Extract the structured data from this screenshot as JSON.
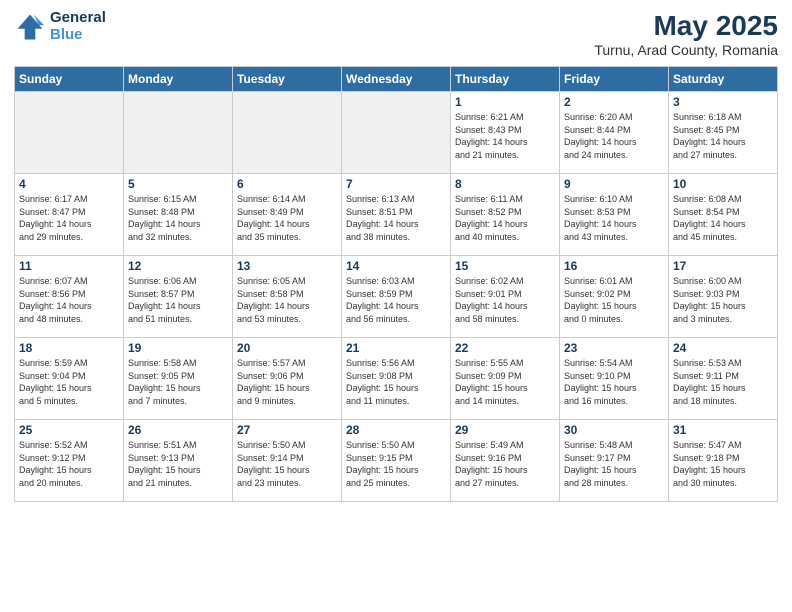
{
  "header": {
    "logo": {
      "general": "General",
      "blue": "Blue"
    },
    "title": "May 2025",
    "subtitle": "Turnu, Arad County, Romania"
  },
  "calendar": {
    "days_of_week": [
      "Sunday",
      "Monday",
      "Tuesday",
      "Wednesday",
      "Thursday",
      "Friday",
      "Saturday"
    ],
    "weeks": [
      [
        {
          "day": "",
          "info": "",
          "empty": true
        },
        {
          "day": "",
          "info": "",
          "empty": true
        },
        {
          "day": "",
          "info": "",
          "empty": true
        },
        {
          "day": "",
          "info": "",
          "empty": true
        },
        {
          "day": "1",
          "info": "Sunrise: 6:21 AM\nSunset: 8:43 PM\nDaylight: 14 hours\nand 21 minutes."
        },
        {
          "day": "2",
          "info": "Sunrise: 6:20 AM\nSunset: 8:44 PM\nDaylight: 14 hours\nand 24 minutes."
        },
        {
          "day": "3",
          "info": "Sunrise: 6:18 AM\nSunset: 8:45 PM\nDaylight: 14 hours\nand 27 minutes."
        }
      ],
      [
        {
          "day": "4",
          "info": "Sunrise: 6:17 AM\nSunset: 8:47 PM\nDaylight: 14 hours\nand 29 minutes."
        },
        {
          "day": "5",
          "info": "Sunrise: 6:15 AM\nSunset: 8:48 PM\nDaylight: 14 hours\nand 32 minutes."
        },
        {
          "day": "6",
          "info": "Sunrise: 6:14 AM\nSunset: 8:49 PM\nDaylight: 14 hours\nand 35 minutes."
        },
        {
          "day": "7",
          "info": "Sunrise: 6:13 AM\nSunset: 8:51 PM\nDaylight: 14 hours\nand 38 minutes."
        },
        {
          "day": "8",
          "info": "Sunrise: 6:11 AM\nSunset: 8:52 PM\nDaylight: 14 hours\nand 40 minutes."
        },
        {
          "day": "9",
          "info": "Sunrise: 6:10 AM\nSunset: 8:53 PM\nDaylight: 14 hours\nand 43 minutes."
        },
        {
          "day": "10",
          "info": "Sunrise: 6:08 AM\nSunset: 8:54 PM\nDaylight: 14 hours\nand 45 minutes."
        }
      ],
      [
        {
          "day": "11",
          "info": "Sunrise: 6:07 AM\nSunset: 8:56 PM\nDaylight: 14 hours\nand 48 minutes."
        },
        {
          "day": "12",
          "info": "Sunrise: 6:06 AM\nSunset: 8:57 PM\nDaylight: 14 hours\nand 51 minutes."
        },
        {
          "day": "13",
          "info": "Sunrise: 6:05 AM\nSunset: 8:58 PM\nDaylight: 14 hours\nand 53 minutes."
        },
        {
          "day": "14",
          "info": "Sunrise: 6:03 AM\nSunset: 8:59 PM\nDaylight: 14 hours\nand 56 minutes."
        },
        {
          "day": "15",
          "info": "Sunrise: 6:02 AM\nSunset: 9:01 PM\nDaylight: 14 hours\nand 58 minutes."
        },
        {
          "day": "16",
          "info": "Sunrise: 6:01 AM\nSunset: 9:02 PM\nDaylight: 15 hours\nand 0 minutes."
        },
        {
          "day": "17",
          "info": "Sunrise: 6:00 AM\nSunset: 9:03 PM\nDaylight: 15 hours\nand 3 minutes."
        }
      ],
      [
        {
          "day": "18",
          "info": "Sunrise: 5:59 AM\nSunset: 9:04 PM\nDaylight: 15 hours\nand 5 minutes."
        },
        {
          "day": "19",
          "info": "Sunrise: 5:58 AM\nSunset: 9:05 PM\nDaylight: 15 hours\nand 7 minutes."
        },
        {
          "day": "20",
          "info": "Sunrise: 5:57 AM\nSunset: 9:06 PM\nDaylight: 15 hours\nand 9 minutes."
        },
        {
          "day": "21",
          "info": "Sunrise: 5:56 AM\nSunset: 9:08 PM\nDaylight: 15 hours\nand 11 minutes."
        },
        {
          "day": "22",
          "info": "Sunrise: 5:55 AM\nSunset: 9:09 PM\nDaylight: 15 hours\nand 14 minutes."
        },
        {
          "day": "23",
          "info": "Sunrise: 5:54 AM\nSunset: 9:10 PM\nDaylight: 15 hours\nand 16 minutes."
        },
        {
          "day": "24",
          "info": "Sunrise: 5:53 AM\nSunset: 9:11 PM\nDaylight: 15 hours\nand 18 minutes."
        }
      ],
      [
        {
          "day": "25",
          "info": "Sunrise: 5:52 AM\nSunset: 9:12 PM\nDaylight: 15 hours\nand 20 minutes."
        },
        {
          "day": "26",
          "info": "Sunrise: 5:51 AM\nSunset: 9:13 PM\nDaylight: 15 hours\nand 21 minutes."
        },
        {
          "day": "27",
          "info": "Sunrise: 5:50 AM\nSunset: 9:14 PM\nDaylight: 15 hours\nand 23 minutes."
        },
        {
          "day": "28",
          "info": "Sunrise: 5:50 AM\nSunset: 9:15 PM\nDaylight: 15 hours\nand 25 minutes."
        },
        {
          "day": "29",
          "info": "Sunrise: 5:49 AM\nSunset: 9:16 PM\nDaylight: 15 hours\nand 27 minutes."
        },
        {
          "day": "30",
          "info": "Sunrise: 5:48 AM\nSunset: 9:17 PM\nDaylight: 15 hours\nand 28 minutes."
        },
        {
          "day": "31",
          "info": "Sunrise: 5:47 AM\nSunset: 9:18 PM\nDaylight: 15 hours\nand 30 minutes."
        }
      ]
    ]
  }
}
